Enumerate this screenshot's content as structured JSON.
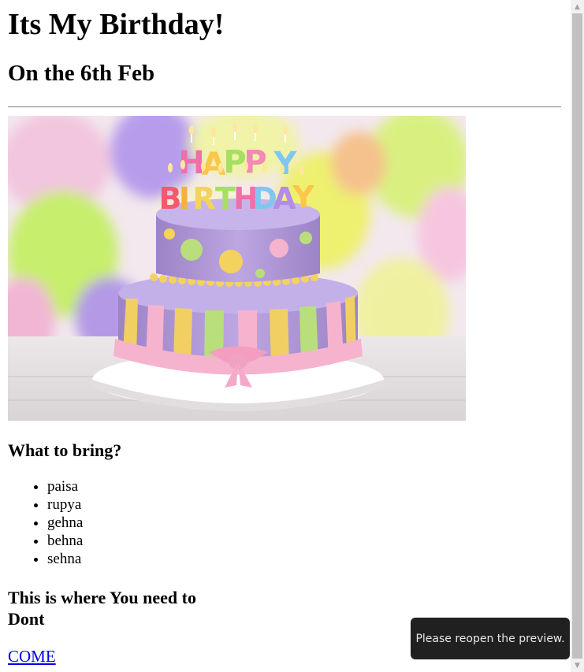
{
  "page": {
    "title": "Its My Birthday!",
    "subtitle": "On the 6th Feb"
  },
  "image": {
    "icon": "birthday-cake-image",
    "candle_letters_top": "HAPPY",
    "candle_letters_bottom": "BIRTHDAY",
    "colors": {
      "background_light": "#f6e9ef",
      "balloon_yellow": "#e8ef6a",
      "balloon_purple": "#b89ee8",
      "balloon_green": "#c6ef7a",
      "balloon_pink": "#f4b8d6",
      "cake_purple": "#b39ad9",
      "cake_ribbon_pink": "#f6b3cd",
      "stripe_yellow": "#f2cf63",
      "stripe_green": "#b9de7c",
      "dot_yellow": "#f3d35d",
      "plate_white": "#f4f2f1"
    }
  },
  "bring": {
    "heading": "What to bring?",
    "items": [
      "paisa",
      "rupya",
      "gehna",
      "behna",
      "sehna"
    ]
  },
  "where": {
    "heading": "This is where You need to Dont"
  },
  "link": {
    "label": "COME",
    "color": "#0000ee"
  },
  "toast": {
    "message": "Please reopen the preview."
  },
  "scrollbar": {
    "up_icon": "arrow-up-icon",
    "down_icon": "arrow-down-icon"
  }
}
